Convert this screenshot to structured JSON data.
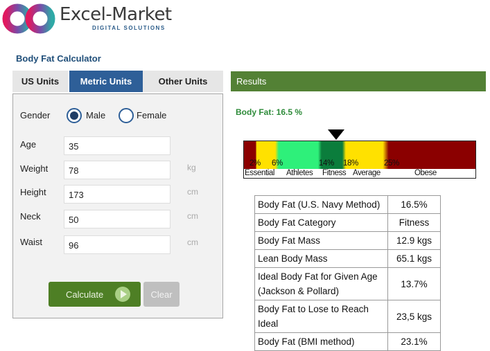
{
  "logo": {
    "name": "Excel-Market",
    "tagline": "DIGITAL SOLUTIONS"
  },
  "title": "Body Fat Calculator",
  "tabs": [
    {
      "label": "US Units"
    },
    {
      "label": "Metric Units"
    },
    {
      "label": "Other Units"
    }
  ],
  "form": {
    "gender_label": "Gender",
    "male": "Male",
    "female": "Female",
    "selected": "Male",
    "fields": [
      {
        "label": "Age",
        "value": "35",
        "unit": ""
      },
      {
        "label": "Weight",
        "value": "78",
        "unit": "kg"
      },
      {
        "label": "Height",
        "value": "173",
        "unit": "cm"
      },
      {
        "label": "Neck",
        "value": "50",
        "unit": "cm"
      },
      {
        "label": "Waist",
        "value": "96",
        "unit": "cm"
      }
    ],
    "calculate": "Calculate",
    "clear": "Clear"
  },
  "results": {
    "header": "Results",
    "body_fat": "Body Fat: 16.5 %",
    "gauge": {
      "value_percent": 16.5,
      "ticks": [
        "2%",
        "6%",
        "14%",
        "18%",
        "25%"
      ],
      "categories": [
        "Essential",
        "Athletes",
        "Fitness",
        "Average",
        "Obese"
      ]
    },
    "table": [
      {
        "k": "Body Fat (U.S. Navy Method)",
        "v": "16.5%"
      },
      {
        "k": "Body Fat Category",
        "v": "Fitness"
      },
      {
        "k": "Body Fat Mass",
        "v": "12.9 kgs"
      },
      {
        "k": "Lean Body Mass",
        "v": "65.1 kgs"
      },
      {
        "k": "Ideal Body Fat for Given Age (Jackson & Pollard)",
        "v": "13.7%"
      },
      {
        "k": "Body Fat to Lose to Reach Ideal",
        "v": "23,5 kgs"
      },
      {
        "k": "Body Fat (BMI method)",
        "v": "23.1%"
      }
    ]
  }
}
